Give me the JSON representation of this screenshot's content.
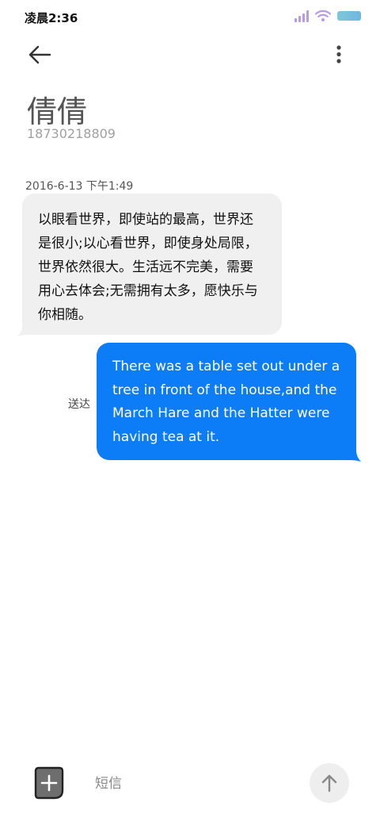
{
  "status_bar": {
    "time": "凌晨2:36"
  },
  "header": {
    "back_icon": "arrow-left-icon",
    "more_icon": "more-vertical-icon"
  },
  "contact": {
    "name": "倩倩",
    "number": "18730218809"
  },
  "conversation": {
    "timestamp": "2016-6-13 下午1:49",
    "received_message": "以眼看世界，即使站的最高，世界还是很小;以心看世界，即使身处局限，世界依然很大。生活远不完美，需要用心去体会;无需拥有太多，愿快乐与你相随。",
    "sent_message": "There was a table set out under a tree in front of the house,and the March Hare and the Hatter were having tea at it.",
    "sent_status": "送达"
  },
  "composer": {
    "placeholder": "短信",
    "attach_icon": "add-attachment-icon",
    "send_icon": "arrow-up-icon"
  },
  "colors": {
    "sent_bubble": "#0c7cf7",
    "received_bubble": "#f0f0f0",
    "signal": "#b79be8",
    "battery": "#6fb6e0"
  }
}
